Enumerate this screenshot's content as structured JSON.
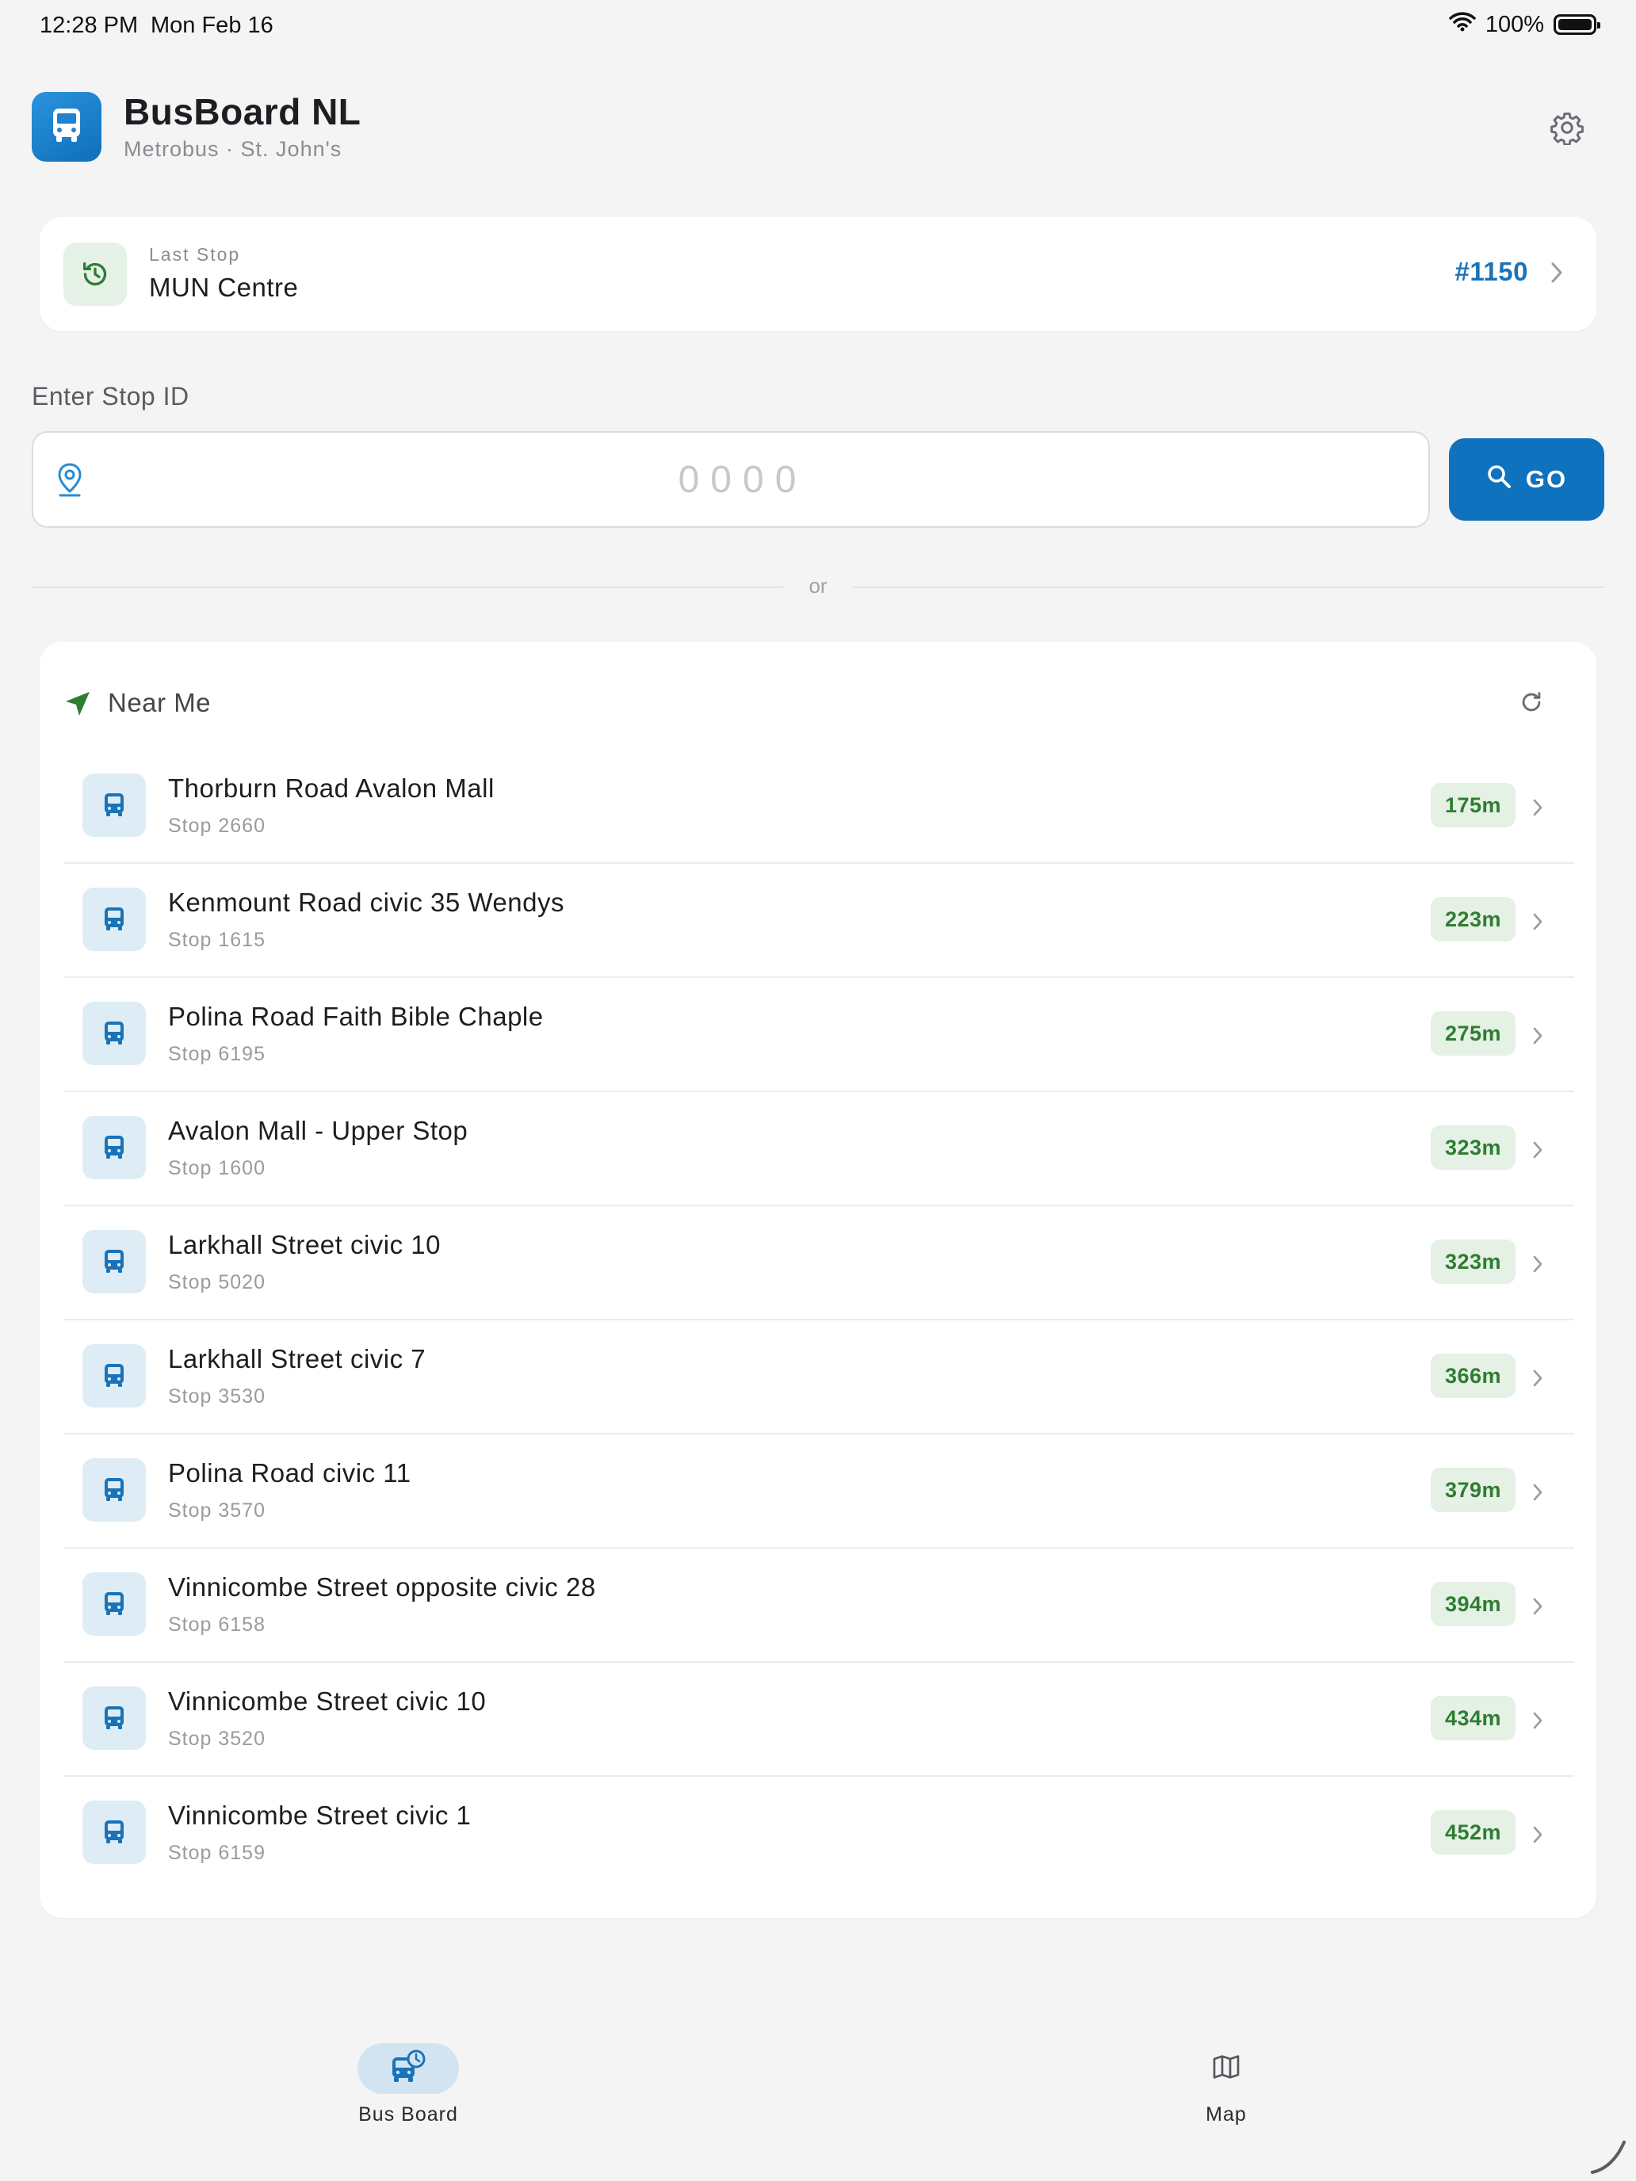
{
  "status_bar": {
    "time": "12:28 PM",
    "date": "Mon Feb 16",
    "battery": "100%",
    "battery_level": 1.0
  },
  "header": {
    "title": "BusBoard NL",
    "subtitle": "Metrobus · St. John's",
    "logo_icon": "bus-icon",
    "settings_icon": "gear-icon"
  },
  "last_stop": {
    "label": "Last Stop",
    "name": "MUN Centre",
    "number": "#1150",
    "icon": "history-icon"
  },
  "stop_entry": {
    "label": "Enter Stop ID",
    "placeholder": "0000",
    "value": "",
    "go_label": "GO"
  },
  "divider": {
    "text": "or"
  },
  "near_me": {
    "title": "Near Me",
    "stops": [
      {
        "name": "Thorburn Road Avalon Mall",
        "stop": "Stop 2660",
        "distance": "175m"
      },
      {
        "name": "Kenmount Road civic 35 Wendys",
        "stop": "Stop 1615",
        "distance": "223m"
      },
      {
        "name": "Polina Road Faith Bible Chaple",
        "stop": "Stop 6195",
        "distance": "275m"
      },
      {
        "name": "Avalon Mall - Upper Stop",
        "stop": "Stop 1600",
        "distance": "323m"
      },
      {
        "name": "Larkhall Street civic 10",
        "stop": "Stop 5020",
        "distance": "323m"
      },
      {
        "name": "Larkhall Street civic 7",
        "stop": "Stop 3530",
        "distance": "366m"
      },
      {
        "name": "Polina Road civic 11",
        "stop": "Stop 3570",
        "distance": "379m"
      },
      {
        "name": "Vinnicombe Street opposite civic 28",
        "stop": "Stop 6158",
        "distance": "394m"
      },
      {
        "name": "Vinnicombe Street civic 10",
        "stop": "Stop 3520",
        "distance": "434m"
      },
      {
        "name": "Vinnicombe Street civic 1",
        "stop": "Stop 6159",
        "distance": "452m"
      }
    ]
  },
  "tabs": [
    {
      "label": "Bus Board",
      "icon": "bus-clock-icon",
      "active": true
    },
    {
      "label": "Map",
      "icon": "map-icon",
      "active": false
    }
  ],
  "colors": {
    "accent": "#0f72bf",
    "green": "#2e7d32",
    "badge_bg": "#e4f1e4",
    "background": "#f4f4f5"
  }
}
